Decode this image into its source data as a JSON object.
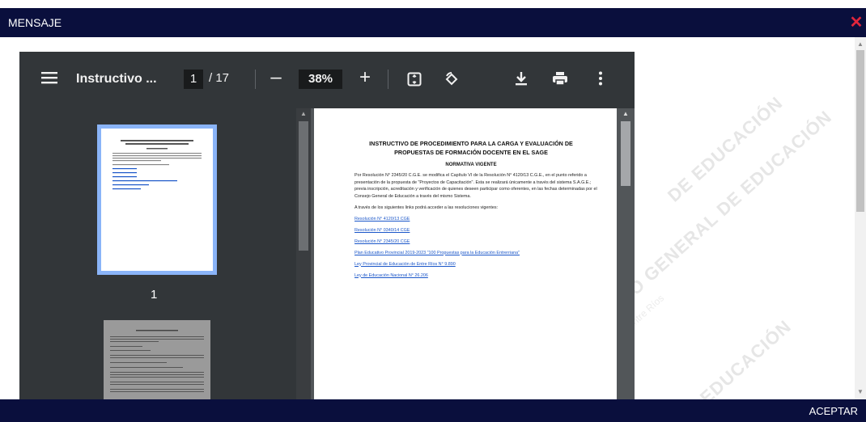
{
  "modal": {
    "title": "MENSAJE",
    "accept_label": "ACEPTAR"
  },
  "viewer": {
    "doc_title": "Instructivo ...",
    "page_current": "1",
    "page_total": "/ 17",
    "zoom": "38%",
    "thumb_page_number": "1"
  },
  "document": {
    "title": "INSTRUCTIVO DE PROCEDIMIENTO PARA LA CARGA Y EVALUACIÓN DE PROPUESTAS DE FORMACIÓN DOCENTE EN EL SAGE",
    "subtitle": "NORMATIVA VIGENTE",
    "para1": "Por Resolución N° 2345/20 C.G.E. se modifica el Capítulo VI de la Resolución N° 4120/13 C.G.E., en el punto referido a presentación de la propuesta de \"Proyectos de Capacitación\". Esta se realizará únicamente a través del sistema S.A.G.E.; previa inscripción, acreditación y verificación de quienes deseen participar como oferentes, en las fechas determinadas por el Consejo General de Educación a través del mismo Sistema.",
    "para2": "A través de los siguientes links podrá acceder a las resoluciones vigentes:",
    "links": [
      "Resolución N° 4120/13 CGE",
      "Resolución N° 0340/14 CGE",
      "Resolución N° 2345/20 CGE",
      "Plan Educativo Provincial 2019-2023 \"100 Propuestas para la Educación Entrerriana\"",
      "Ley Provincial de Educación de Entre Ríos N° 9.890",
      "Ley de Educación Nacional N° 26.206"
    ]
  },
  "watermark": {
    "text1": "CONSEJO GENERAL DE EDUCACIÓN",
    "text2": "Gobierno de Entre Ríos",
    "text3": "DE EDUCACIÓN",
    "text4": "EDUCACIÓN"
  },
  "colors": {
    "header_bg": "#0a0f3d",
    "close": "#e0263c",
    "viewer_toolbar": "#323639"
  }
}
